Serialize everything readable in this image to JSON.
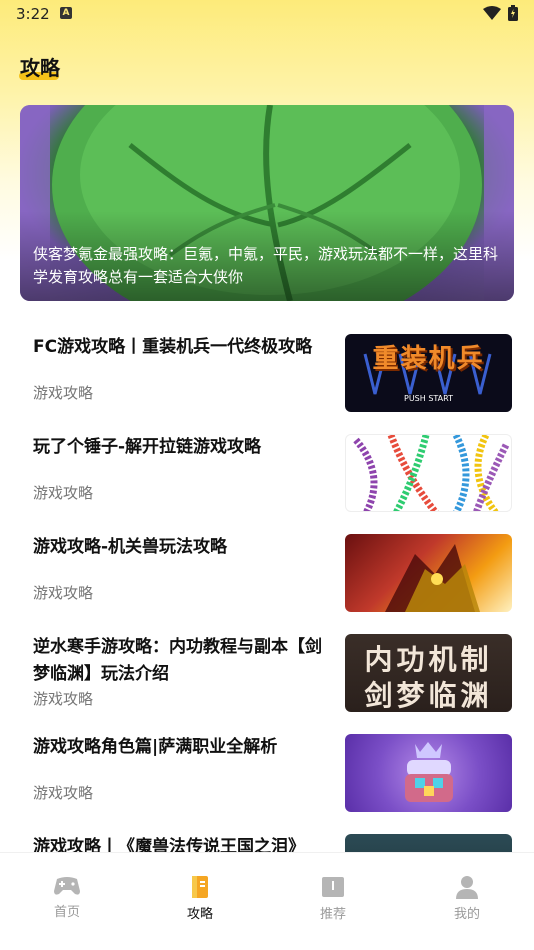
{
  "status_bar": {
    "time": "3:22",
    "notification_letter": "A"
  },
  "page": {
    "title": "攻略"
  },
  "hero": {
    "caption": "侠客梦氪金最强攻略：巨氪，中氪，平民，游戏玩法都不一样，这里科学发育攻略总有一套适合大侠你"
  },
  "articles": [
    {
      "title": "FC游戏攻略丨重装机兵一代终极攻略",
      "category": "游戏攻略",
      "thumb_text": "重装机兵",
      "thumb_subtext": "PUSH START",
      "thumb_icon": "metal-max-thumb"
    },
    {
      "title": "玩了个锤子-解开拉链游戏攻略",
      "category": "游戏攻略",
      "thumb_icon": "zipper-game-thumb"
    },
    {
      "title": "游戏攻略-机关兽玩法攻略",
      "category": "游戏攻略",
      "thumb_icon": "mech-beast-thumb"
    },
    {
      "title": "逆水寒手游攻略：内功教程与副本【剑梦临渊】玩法介绍",
      "category": "游戏攻略",
      "thumb_line1": "内功机制",
      "thumb_line2": "剑梦临渊",
      "thumb_icon": "calligraphy-thumb"
    },
    {
      "title": "游戏攻略角色篇|萨满职业全解析",
      "category": "游戏攻略",
      "thumb_icon": "treasure-chest-thumb"
    },
    {
      "title": "游戏攻略丨《魔兽法传说王国之泪》",
      "category": "",
      "thumb_icon": "dark-thumb"
    }
  ],
  "tabbar": {
    "tabs": [
      {
        "label": "首页",
        "icon": "gamepad-icon",
        "active": false
      },
      {
        "label": "攻略",
        "icon": "book-icon",
        "active": true
      },
      {
        "label": "推荐",
        "icon": "recommend-icon",
        "active": false
      },
      {
        "label": "我的",
        "icon": "person-icon",
        "active": false
      }
    ]
  },
  "colors": {
    "accent": "#f5c21a",
    "header_yellow": "#fdeb7a"
  }
}
